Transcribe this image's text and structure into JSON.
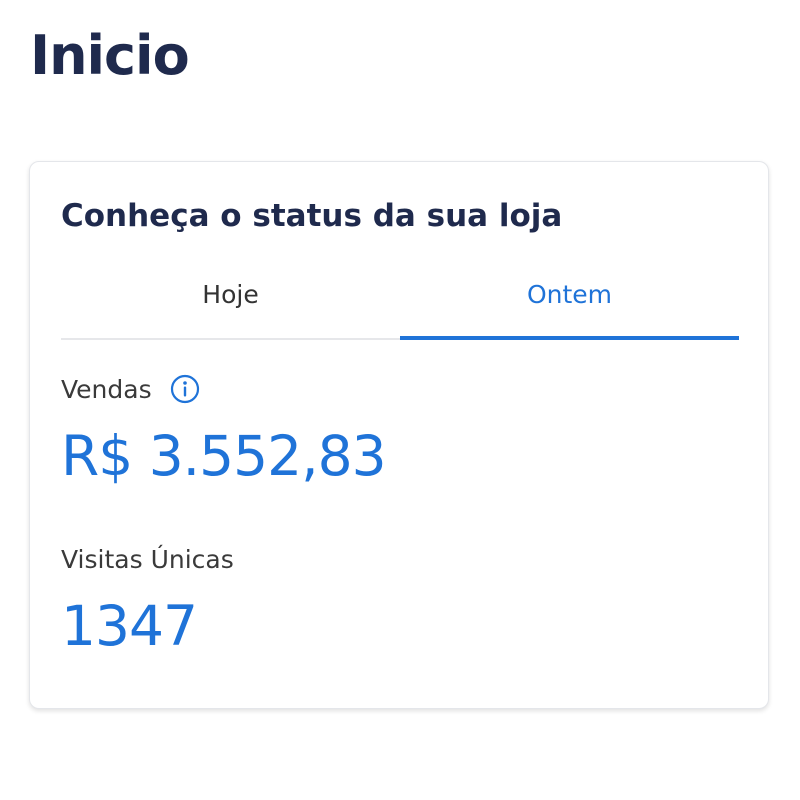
{
  "header": {
    "title": "Inicio"
  },
  "store_status_card": {
    "title": "Conheça o status da sua loja",
    "tabs": [
      {
        "label": "Hoje",
        "active": false
      },
      {
        "label": "Ontem",
        "active": true
      }
    ],
    "metrics": {
      "sales": {
        "label": "Vendas",
        "icon": "info-icon",
        "value": "R$ 3.552,83"
      },
      "unique_visits": {
        "label": "Visitas Únicas",
        "value": "1347"
      }
    }
  },
  "colors": {
    "title": "#1f2a4d",
    "accent": "#1f73d8",
    "text": "#3a3a3a",
    "divider": "#e6e7ea"
  }
}
